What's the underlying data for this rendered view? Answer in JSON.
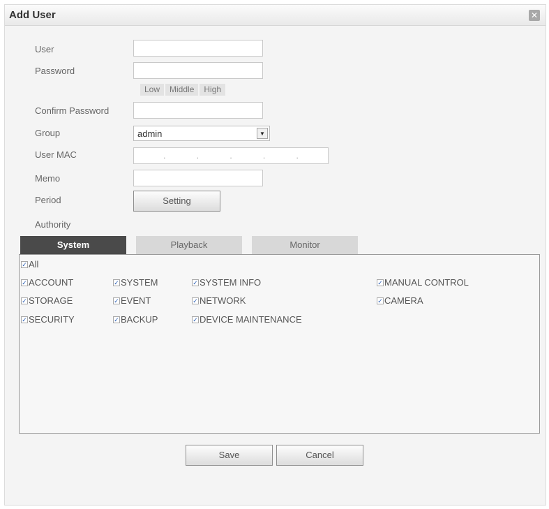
{
  "dialog": {
    "title": "Add User",
    "close_symbol": "✕"
  },
  "form": {
    "user_label": "User",
    "password_label": "Password",
    "strength": [
      "Low",
      "Middle",
      "High"
    ],
    "confirm_label": "Confirm Password",
    "group_label": "Group",
    "group_value": "admin",
    "mac_label": "User MAC",
    "mac_separators": [
      ".",
      ".",
      ".",
      ".",
      "."
    ],
    "memo_label": "Memo",
    "period_label": "Period",
    "setting_button": "Setting",
    "authority_label": "Authority"
  },
  "tabs": [
    "System",
    "Playback",
    "Monitor"
  ],
  "checks": {
    "all": "All",
    "account": "ACCOUNT",
    "system": "SYSTEM",
    "system_info": "SYSTEM INFO",
    "manual_control": "MANUAL CONTROL",
    "storage": "STORAGE",
    "event": "EVENT",
    "network": "NETWORK",
    "camera": "CAMERA",
    "security": "SECURITY",
    "backup": "BACKUP",
    "device_maintenance": "DEVICE MAINTENANCE",
    "check_mark": "✓"
  },
  "footer": {
    "save": "Save",
    "cancel": "Cancel"
  }
}
